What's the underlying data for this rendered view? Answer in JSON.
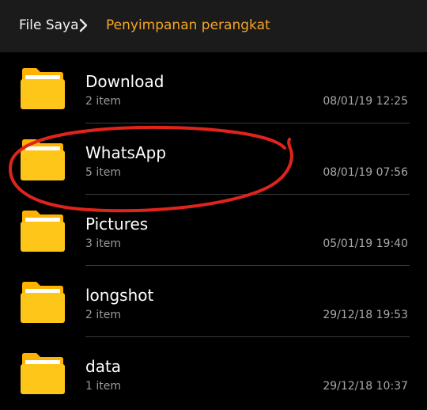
{
  "header": {
    "root_label": "File Saya",
    "current_label": "Penyimpanan perangkat",
    "separator_icon": "chevron-right-icon"
  },
  "colors": {
    "header_bg": "#1b1b1b",
    "accent": "#f5a623",
    "folder_yellow": "#ffc61a",
    "annotation_red": "#e0241c"
  },
  "folders": [
    {
      "name": "Download",
      "count": "2 item",
      "date": "08/01/19 12:25"
    },
    {
      "name": "WhatsApp",
      "count": "5 item",
      "date": "08/01/19 07:56"
    },
    {
      "name": "Pictures",
      "count": "3 item",
      "date": "05/01/19 19:40"
    },
    {
      "name": "longshot",
      "count": "2 item",
      "date": "29/12/18 19:53"
    },
    {
      "name": "data",
      "count": "1 item",
      "date": "29/12/18 10:37"
    }
  ]
}
